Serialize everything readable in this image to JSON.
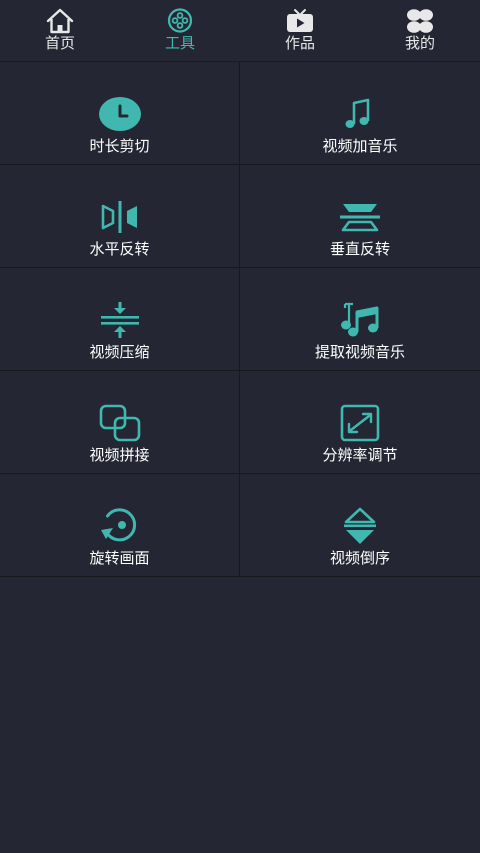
{
  "colors": {
    "background": "#242733",
    "accent": "#40b8b0",
    "divider": "#17191f",
    "nav_icon_inactive": "#e8e8e8"
  },
  "nav": {
    "tabs": [
      {
        "label": "首页",
        "icon": "home-icon",
        "active": false
      },
      {
        "label": "工具",
        "icon": "film-reel-icon",
        "active": true
      },
      {
        "label": "作品",
        "icon": "tv-play-icon",
        "active": false
      },
      {
        "label": "我的",
        "icon": "clover-icon",
        "active": false
      }
    ]
  },
  "tools": [
    {
      "label": "时长剪切",
      "icon": "clock-icon"
    },
    {
      "label": "视频加音乐",
      "icon": "music-note-icon"
    },
    {
      "label": "水平反转",
      "icon": "flip-horizontal-icon"
    },
    {
      "label": "垂直反转",
      "icon": "flip-vertical-icon"
    },
    {
      "label": "视频压缩",
      "icon": "compress-icon"
    },
    {
      "label": "提取视频音乐",
      "icon": "extract-music-icon"
    },
    {
      "label": "视频拼接",
      "icon": "merge-squares-icon"
    },
    {
      "label": "分辨率调节",
      "icon": "resize-icon"
    },
    {
      "label": "旋转画面",
      "icon": "rotate-icon"
    },
    {
      "label": "视频倒序",
      "icon": "reverse-order-icon"
    }
  ]
}
